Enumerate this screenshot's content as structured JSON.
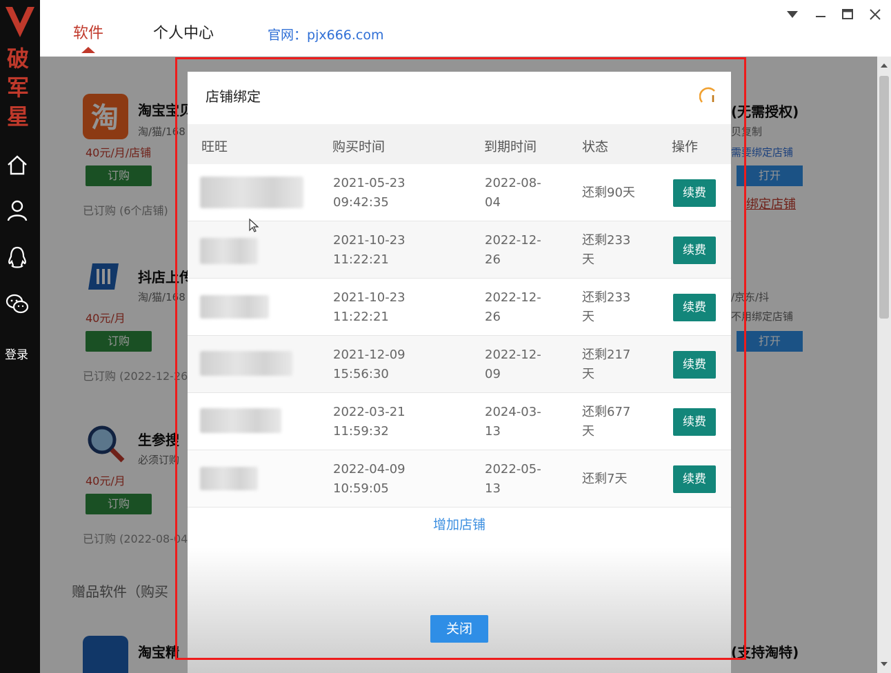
{
  "sidebar": {
    "brand": "破军星",
    "login_label": "登录"
  },
  "topbar": {
    "tabs": [
      {
        "label": "软件",
        "active": true
      },
      {
        "label": "个人中心",
        "active": false
      }
    ],
    "site_label": "官网：",
    "site_url": "pjx666.com"
  },
  "main": {
    "apps_left": [
      {
        "name": "淘宝宝贝",
        "sub": "淘/猫/168",
        "price": "40元/月/店铺",
        "order_label": "订购",
        "subscribed": "已订购 (6个店铺)"
      },
      {
        "name": "抖店上传",
        "sub": "淘/猫/168",
        "price": "40元/月",
        "order_label": "订购",
        "subscribed": "已订购 (2022-12-26"
      },
      {
        "name": "生参搜",
        "sub": "必须订购",
        "price": "40元/月",
        "order_label": "订购",
        "subscribed": "已订购 (2022-08-04"
      }
    ],
    "apps_right": [
      {
        "title": "(无需授权)",
        "note": "贝复制",
        "blue": "需要绑定店铺",
        "open_label": "打开",
        "bind_label": "绑定店铺"
      },
      {
        "note1": "/京东/抖",
        "note2": "不用绑定店铺",
        "open_label": "打开"
      }
    ],
    "gift_title": "赠品软件（购买",
    "bottom_left": "淘宝精",
    "bottom_right": "(支持淘特)"
  },
  "modal": {
    "title": "店铺绑定",
    "columns": [
      "旺旺",
      "购买时间",
      "到期时间",
      "状态",
      "操作"
    ],
    "rows": [
      {
        "purchase_date": "2021-05-23",
        "purchase_time": "09:42:35",
        "expire_1": "2022-08-",
        "expire_2": "04",
        "status_1": "还剩90天",
        "status_2": "",
        "action": "续费"
      },
      {
        "purchase_date": "2021-10-23",
        "purchase_time": "11:22:21",
        "expire_1": "2022-12-",
        "expire_2": "26",
        "status_1": "还剩233",
        "status_2": "天",
        "action": "续费"
      },
      {
        "purchase_date": "2021-10-23",
        "purchase_time": "11:22:21",
        "expire_1": "2022-12-",
        "expire_2": "26",
        "status_1": "还剩233",
        "status_2": "天",
        "action": "续费"
      },
      {
        "purchase_date": "2021-12-09",
        "purchase_time": "15:56:30",
        "expire_1": "2022-12-",
        "expire_2": "09",
        "status_1": "还剩217",
        "status_2": "天",
        "action": "续费"
      },
      {
        "purchase_date": "2022-03-21",
        "purchase_time": "11:59:32",
        "expire_1": "2024-03-",
        "expire_2": "13",
        "status_1": "还剩677",
        "status_2": "天",
        "action": "续费"
      },
      {
        "purchase_date": "2022-04-09",
        "purchase_time": "10:59:05",
        "expire_1": "2022-05-",
        "expire_2": "13",
        "status_1": "还剩7天",
        "status_2": "",
        "action": "续费"
      }
    ],
    "add_shop_label": "增加店铺",
    "close_label": "关闭"
  },
  "colors": {
    "brand_red": "#c0392b",
    "renew_teal": "#13867a",
    "primary_blue": "#2f8ee6",
    "highlight_red": "#ee1c1c"
  }
}
